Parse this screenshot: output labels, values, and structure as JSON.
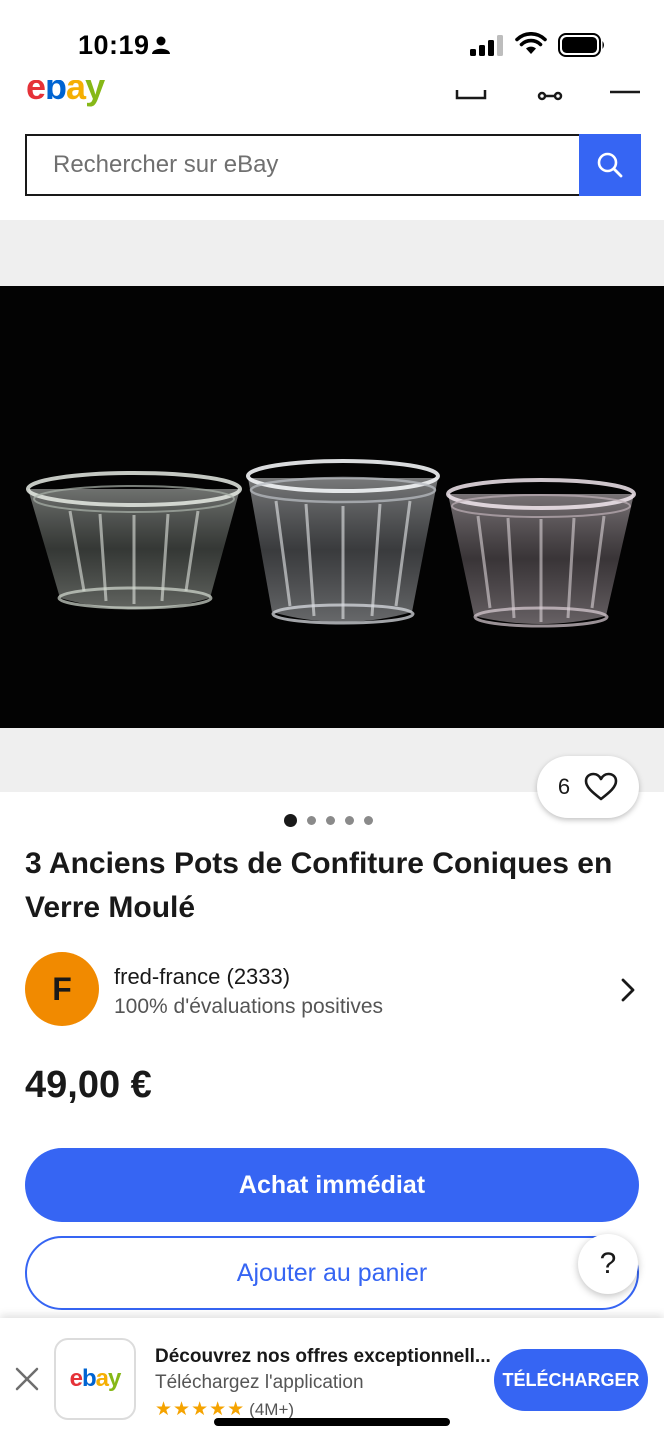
{
  "status_bar": {
    "time": "10:19"
  },
  "header": {
    "logo_letters": [
      "e",
      "b",
      "a",
      "y"
    ]
  },
  "search": {
    "placeholder": "Rechercher sur eBay"
  },
  "listing": {
    "watch_count": "6",
    "image_count": 5,
    "active_image": 1,
    "title": "3 Anciens Pots de Confiture Coniques en Verre Moulé",
    "seller": {
      "initial": "F",
      "name": "fred-france (2333)",
      "feedback": "100% d'évaluations positives"
    },
    "price": "49,00 €",
    "buy_now_label": "Achat immédiat",
    "add_to_cart_label": "Ajouter au panier",
    "help_label": "?"
  },
  "app_banner": {
    "logo_letters": [
      "e",
      "b",
      "a",
      "y"
    ],
    "title": "Découvrez nos offres exceptionnell...",
    "subtitle": "Téléchargez l'application",
    "stars": "★★★★★",
    "rating_count": "(4M+)",
    "download_label": "TÉLÉCHARGER"
  },
  "colors": {
    "accent": "#3665f3",
    "ebay_red": "#e53238",
    "ebay_blue": "#0064d2",
    "ebay_yellow": "#f5af02",
    "ebay_green": "#86b817",
    "seller_avatar": "#f18a00"
  }
}
